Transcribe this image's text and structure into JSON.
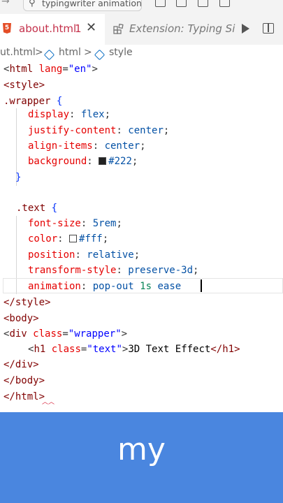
{
  "titlebar": {
    "search_text": "typingwriter animation"
  },
  "tabs": [
    {
      "label": "about.html",
      "badge": "1",
      "close": "✕"
    },
    {
      "label": "Extension: Typing Simu"
    }
  ],
  "breadcrumb": {
    "file": "ut.html",
    "sep1": ">",
    "node1": "html",
    "sep2": ">",
    "node2": "style"
  },
  "code": {
    "l1": {
      "open": "<",
      "tag": "html",
      "sp": " ",
      "attr": "lang",
      "eq": "=",
      "str": "\"en\"",
      "close": ">"
    },
    "l2": {
      "text": "<style>"
    },
    "l3": {
      "sel": ".wrapper",
      "brace": " {"
    },
    "l4": {
      "prop": "display",
      "colon": ": ",
      "val": "flex",
      "semi": ";"
    },
    "l5": {
      "prop": "justify-content",
      "colon": ": ",
      "val": "center",
      "semi": ";"
    },
    "l6": {
      "prop": "align-items",
      "colon": ": ",
      "val": "center",
      "semi": ";"
    },
    "l7": {
      "prop": "background",
      "colon": ": ",
      "val": "#222",
      "semi": ";",
      "swatch": "#222222"
    },
    "l8": {
      "brace": "}"
    },
    "l10": {
      "sel": ".text",
      "brace": " {"
    },
    "l11": {
      "prop": "font-size",
      "colon": ": ",
      "val": "5rem",
      "semi": ";"
    },
    "l12": {
      "prop": "color",
      "colon": ": ",
      "val": "#fff",
      "semi": ";",
      "swatch": "#ffffff"
    },
    "l13": {
      "prop": "position",
      "colon": ": ",
      "val": "relative",
      "semi": ";"
    },
    "l14": {
      "prop": "transform-style",
      "colon": ": ",
      "val": "preserve-3d",
      "semi": ";"
    },
    "l15": {
      "prop": "animation",
      "colon": ": ",
      "val1": "pop-out",
      "sp": " ",
      "val2": "1s",
      "val3": " ease "
    },
    "l16": {
      "text": "</style>"
    },
    "l17": {
      "text": "<body>"
    },
    "l18": {
      "open": "<",
      "tag": "div",
      "sp": " ",
      "attr": "class",
      "eq": "=",
      "str": "\"wrapper\"",
      "close": ">"
    },
    "l19": {
      "open": "<",
      "tag": "h1",
      "sp": " ",
      "attr": "class",
      "eq": "=",
      "str": "\"text\"",
      "close": ">",
      "content": "3D Text Effect",
      "end": "</h1>"
    },
    "l20": {
      "text": "</div>"
    },
    "l21": {
      "text": "</body>"
    },
    "l22": {
      "text": "</html>"
    }
  },
  "caption": {
    "text": "my"
  }
}
